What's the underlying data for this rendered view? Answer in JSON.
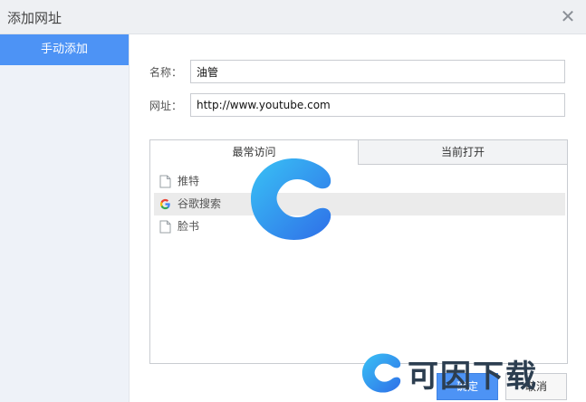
{
  "window": {
    "title": "添加网址",
    "close_icon": "close-icon"
  },
  "sidebar": {
    "items": [
      {
        "label": "手动添加",
        "active": true
      }
    ]
  },
  "form": {
    "name": {
      "label": "名称：",
      "value": "油管"
    },
    "url": {
      "label": "网址：",
      "value": "http://www.youtube.com"
    }
  },
  "tabs": [
    {
      "label": "最常访问",
      "active": true
    },
    {
      "label": "当前打开",
      "active": false
    }
  ],
  "list": [
    {
      "label": "推特",
      "icon": "page-icon"
    },
    {
      "label": "谷歌搜索",
      "icon": "google-icon",
      "highlighted": true
    },
    {
      "label": "脸书",
      "icon": "page-icon"
    }
  ],
  "buttons": {
    "ok": "确定",
    "cancel": "取消"
  },
  "watermark": {
    "text": "可因下载"
  },
  "colors": {
    "accent": "#4d93f5",
    "titlebar": "#eef0f3",
    "sidebar": "#eef2f8"
  }
}
